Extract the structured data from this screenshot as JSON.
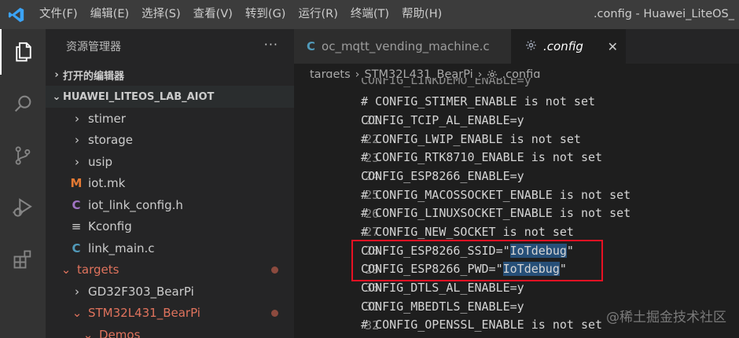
{
  "titlebar": {
    "menu": [
      "文件(F)",
      "编辑(E)",
      "选择(S)",
      "查看(V)",
      "转到(G)",
      "运行(R)",
      "终端(T)",
      "帮助(H)"
    ],
    "window_title": ".config - Huawei_LiteOS_"
  },
  "activity_bar": {
    "icons": [
      "explorer-icon",
      "search-icon",
      "source-control-icon",
      "run-debug-icon",
      "extensions-icon"
    ]
  },
  "sidebar": {
    "header": "资源管理器",
    "more": "···",
    "open_editors": "打开的编辑器",
    "workspace": "HUAWEI_LITEOS_LAB_AIOT",
    "items": [
      {
        "label": "stimer",
        "kind": "folder",
        "chevron": "›"
      },
      {
        "label": "storage",
        "kind": "folder",
        "chevron": "›"
      },
      {
        "label": "usip",
        "kind": "folder",
        "chevron": "›"
      },
      {
        "label": "iot.mk",
        "kind": "file",
        "icon": "M",
        "icon_color": "#e37933"
      },
      {
        "label": "iot_link_config.h",
        "kind": "file",
        "icon": "C",
        "icon_color": "#a074c4"
      },
      {
        "label": "Kconfig",
        "kind": "file",
        "icon": "≡",
        "icon_color": "#cccccc"
      },
      {
        "label": "link_main.c",
        "kind": "file",
        "icon": "C",
        "icon_color": "#519aba"
      },
      {
        "label": "targets",
        "kind": "folder-open",
        "color": "#e0735d"
      },
      {
        "label": "GD32F303_BearPi",
        "kind": "folder"
      },
      {
        "label": "STM32L431_BearPi",
        "kind": "folder-open",
        "color": "#e0735d"
      },
      {
        "label": "Demos",
        "kind": "folder-open",
        "color": "#e0735d"
      }
    ]
  },
  "tabs": [
    {
      "label": "oc_mqtt_vending_machine.c",
      "icon": "C",
      "active": false
    },
    {
      "label": ".config",
      "icon": "gear-icon",
      "active": true,
      "close": "✕"
    }
  ],
  "breadcrumb": [
    "targets",
    "STM32L431_BearPi",
    ".config"
  ],
  "editor": {
    "lines": [
      {
        "n": "",
        "text": "CONFIG_LINKDEMO_ENABLE=y"
      },
      {
        "n": "21",
        "text": "# CONFIG_STIMER_ENABLE is not set"
      },
      {
        "n": "22",
        "text": "CONFIG_TCIP_AL_ENABLE=y"
      },
      {
        "n": "23",
        "text": "# CONFIG_LWIP_ENABLE is not set"
      },
      {
        "n": "24",
        "text": "# CONFIG_RTK8710_ENABLE is not set"
      },
      {
        "n": "25",
        "text": "CONFIG_ESP8266_ENABLE=y"
      },
      {
        "n": "26",
        "text": "# CONFIG_MACOSSOCKET_ENABLE is not set"
      },
      {
        "n": "27",
        "text": "# CONFIG_LINUXSOCKET_ENABLE is not set"
      },
      {
        "n": "28",
        "text": "# CONFIG_NEW_SOCKET is not set"
      },
      {
        "n": "29",
        "pre": "CONFIG_ESP8266_SSID=\"",
        "sel": "IoTdebug",
        "post": "\""
      },
      {
        "n": "30",
        "pre": "CONFIG_ESP8266_PWD=\"",
        "sel": "IoTdebug",
        "post": "\""
      },
      {
        "n": "31",
        "text": "CONFIG_DTLS_AL_ENABLE=y"
      },
      {
        "n": "32",
        "text": "CONFIG_MBEDTLS_ENABLE=y"
      },
      {
        "n": "33",
        "text": "# CONFIG_OPENSSL_ENABLE is not set"
      }
    ]
  },
  "watermark": "@稀土掘金技术社区",
  "colors": {
    "accent_red": "#e81123",
    "selection": "#264f78",
    "git_modified": "#e0735d"
  }
}
